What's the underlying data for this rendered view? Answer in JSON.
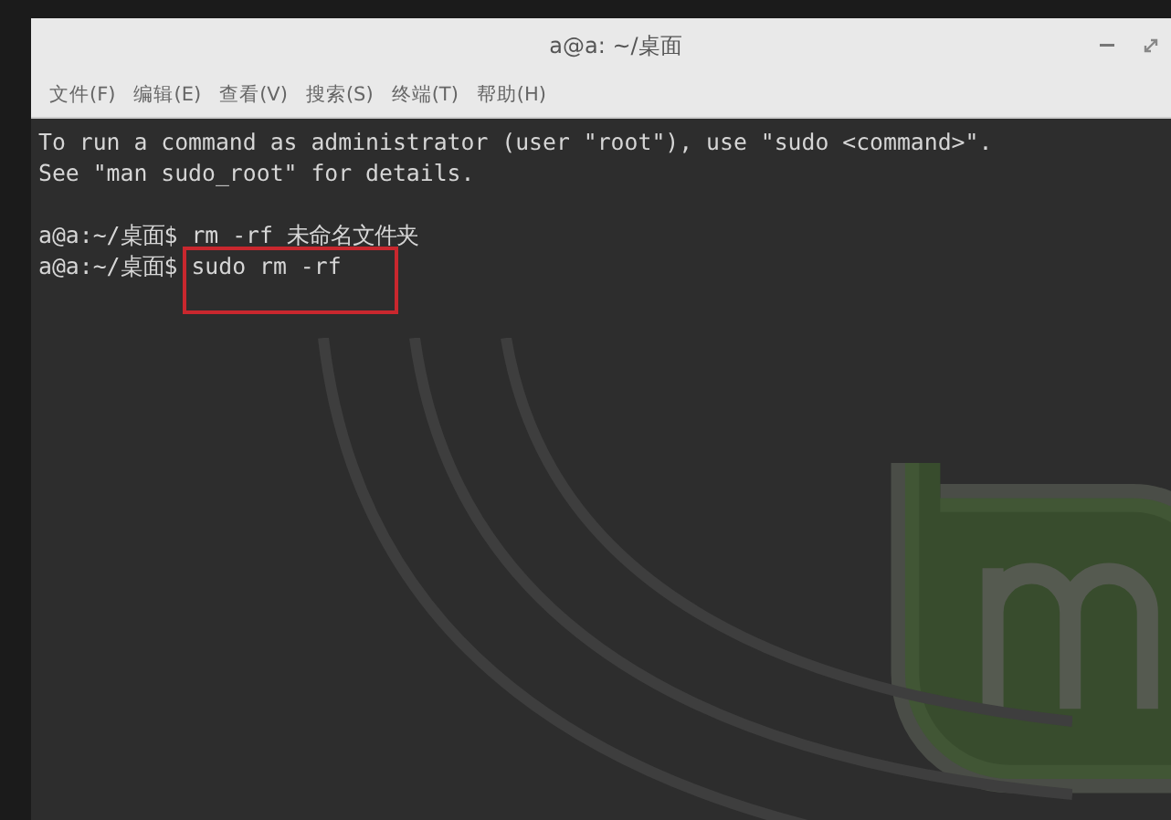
{
  "window": {
    "title": "a@a: ~/桌面"
  },
  "menu": [
    {
      "label": "文件(F)"
    },
    {
      "label": "编辑(E)"
    },
    {
      "label": "查看(V)"
    },
    {
      "label": "搜索(S)"
    },
    {
      "label": "终端(T)"
    },
    {
      "label": "帮助(H)"
    }
  ],
  "terminal": {
    "lines": [
      {
        "kind": "output",
        "text": "To run a command as administrator (user \"root\"), use \"sudo <command>\"."
      },
      {
        "kind": "output",
        "text": "See \"man sudo_root\" for details."
      },
      {
        "kind": "prompt",
        "prompt": "a@a:~/桌面$",
        "command": "rm -rf 未命名文件夹",
        "highlighted": false
      },
      {
        "kind": "prompt",
        "prompt": "a@a:~/桌面$",
        "command": "sudo rm -rf",
        "highlighted": true
      }
    ]
  }
}
